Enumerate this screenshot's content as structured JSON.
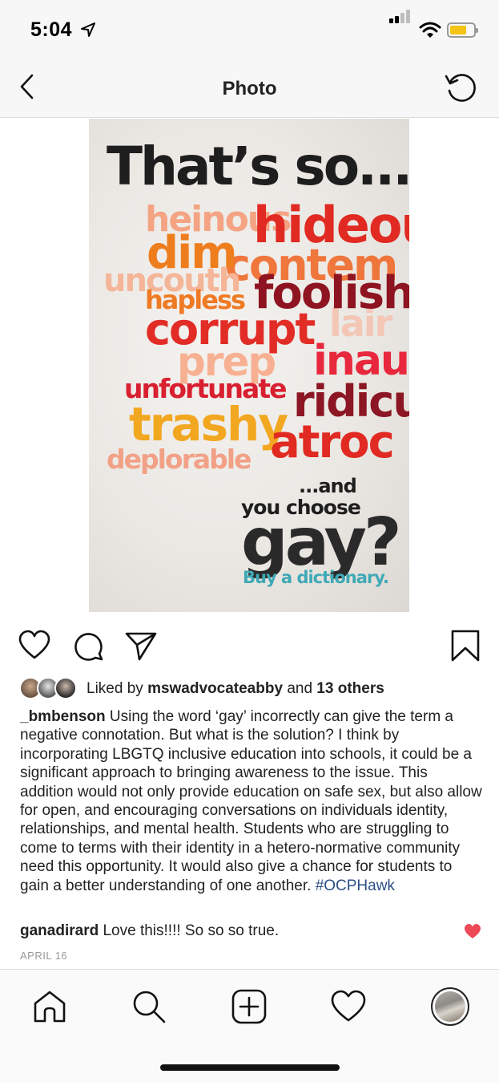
{
  "status_bar": {
    "time": "5:04",
    "icons": [
      "location-arrow-icon",
      "cellular-signal-icon",
      "wifi-icon",
      "battery-icon"
    ],
    "battery_color": "#f3c316"
  },
  "nav": {
    "title": "Photo",
    "back_icon": "chevron-left-icon",
    "refresh_icon": "refresh-icon"
  },
  "poster": {
    "headline": "That’s so...",
    "words": [
      {
        "text": "heinous",
        "color": "#f4a483"
      },
      {
        "text": "hideou",
        "color": "#e02a22"
      },
      {
        "text": "dim",
        "color": "#ee7d1e"
      },
      {
        "text": "contem",
        "color": "#f06a2a"
      },
      {
        "text": "uncouth",
        "color": "#f5b598"
      },
      {
        "text": "hapless",
        "color": "#ef7a24"
      },
      {
        "text": "foolish",
        "color": "#8e1421"
      },
      {
        "text": "corrupt",
        "color": "#e22c26"
      },
      {
        "text": "lair",
        "color": "#f3c6b5"
      },
      {
        "text": "prep",
        "color": "#f7b192"
      },
      {
        "text": "inau",
        "color": "#e8283c"
      },
      {
        "text": "unfortunate",
        "color": "#d82030"
      },
      {
        "text": "ridicu",
        "color": "#8c1623"
      },
      {
        "text": "trashy",
        "color": "#f2a720"
      },
      {
        "text": "atroc",
        "color": "#e02a22"
      },
      {
        "text": "deplorable",
        "color": "#f2a186"
      }
    ],
    "line1": "...and",
    "line2": "you choose",
    "line3": "gay?",
    "tagline": "Buy a dictionary.",
    "tagline_color": "#3fa9b5"
  },
  "actions": {
    "like_icon": "heart-icon",
    "comment_icon": "comment-icon",
    "share_icon": "paper-plane-icon",
    "save_icon": "bookmark-icon"
  },
  "likes": {
    "prefix": "Liked by",
    "user": "mswadvocateabby",
    "middle": "and",
    "others": "13 others"
  },
  "caption": {
    "user": "_bmbenson",
    "text": "Using the word ‘gay’ incorrectly can give the term a negative connotation. But what is the solution? I think by incorporating LBGTQ inclusive education into schools, it could be a significant approach to bringing awareness to the issue. This addition would not only provide education on safe sex, but also allow for open, and encouraging conversations on individuals identity, relationships, and mental health. Students who are struggling to come to terms with their identity in a hetero-normative community need this opportunity. It would also give a chance for students to gain a better understanding of one another.",
    "hashtag": "#OCPHawk"
  },
  "comment": {
    "user": "ganadirard",
    "text": "Love this!!!! So so so true.",
    "liked_color": "#ed4956"
  },
  "date": "APRIL 16",
  "tab_bar": {
    "items": [
      "home-icon",
      "search-icon",
      "new-post-icon",
      "activity-heart-icon",
      "profile-avatar"
    ]
  }
}
